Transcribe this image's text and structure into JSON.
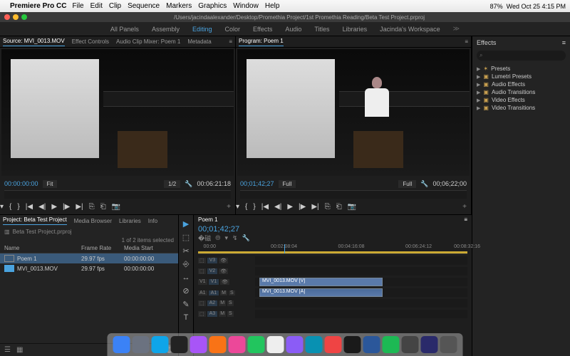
{
  "menubar": {
    "app": "Premiere Pro CC",
    "items": [
      "File",
      "Edit",
      "Clip",
      "Sequence",
      "Markers",
      "Graphics",
      "Window",
      "Help"
    ],
    "battery": "87%",
    "clock": "Wed Oct 25  4:15 PM"
  },
  "titlebar": {
    "path": "/Users/jacindaalexander/Desktop/Promethia Project/1st Promethia Reading/Beta Test Project.prproj"
  },
  "workspaces": {
    "items": [
      "All Panels",
      "Assembly",
      "Editing",
      "Color",
      "Effects",
      "Audio",
      "Titles",
      "Libraries",
      "Jacinda's Workspace"
    ],
    "active": "Editing"
  },
  "source": {
    "tabs": {
      "main": "Source: MVI_0013.MOV",
      "others": [
        "Effect Controls",
        "Audio Clip Mixer: Poem 1",
        "Metadata"
      ]
    },
    "tc_in": "00:00:00:00",
    "fit": "Fit",
    "half": "1/2",
    "tc_out": "00:06:21:18"
  },
  "program": {
    "tab": "Program: Poem 1",
    "tc_in": "00;01;42;27",
    "fit": "Full",
    "tc_out": "00;06;22;00"
  },
  "project": {
    "tabs": [
      "Project: Beta Test Project",
      "Media Browser",
      "Libraries",
      "Info"
    ],
    "crumb": "Beta Test Project.prproj",
    "selection": "1 of 2 items selected",
    "columns": [
      "Name",
      "Frame Rate",
      "Media Start"
    ],
    "rows": [
      {
        "name": "Poem 1",
        "rate": "29.97 fps",
        "start": "00:00:00:00",
        "type": "seq"
      },
      {
        "name": "MVI_0013.MOV",
        "rate": "29.97 fps",
        "start": "00:00:00:00",
        "type": "clip"
      }
    ]
  },
  "tools": [
    "▶",
    "⬚",
    "✂",
    "⎆",
    "↔",
    "⊘",
    "✎",
    "T"
  ],
  "timeline": {
    "tab": "Poem 1",
    "tc": "00;01;42;27",
    "ticks": [
      "00:00",
      "00:02:08:04",
      "00:04:16:08",
      "00:06:24:12",
      "00:08:32:16"
    ],
    "tracks": {
      "v": [
        "V3",
        "V2",
        "V1"
      ],
      "a": [
        "A1",
        "A2",
        "A3"
      ]
    },
    "clip_v": "MVI_0013.MOV [V]",
    "clip_a": "MVI_0013.MOV [A]"
  },
  "effects": {
    "title": "Effects",
    "search_ph": "⌕",
    "items": [
      "Presets",
      "Lumetri Presets",
      "Audio Effects",
      "Audio Transitions",
      "Video Effects",
      "Video Transitions"
    ]
  },
  "dock_colors": [
    "#3b82f6",
    "#6b7280",
    "#0ea5e9",
    "#222",
    "#a855f7",
    "#f97316",
    "#ec4899",
    "#22c55e",
    "#eee",
    "#8b5cf6",
    "#0891b2",
    "#ef4444",
    "#1a1a1a",
    "#2b579a",
    "#1db954",
    "#444",
    "#2a2a6a",
    "#555"
  ]
}
